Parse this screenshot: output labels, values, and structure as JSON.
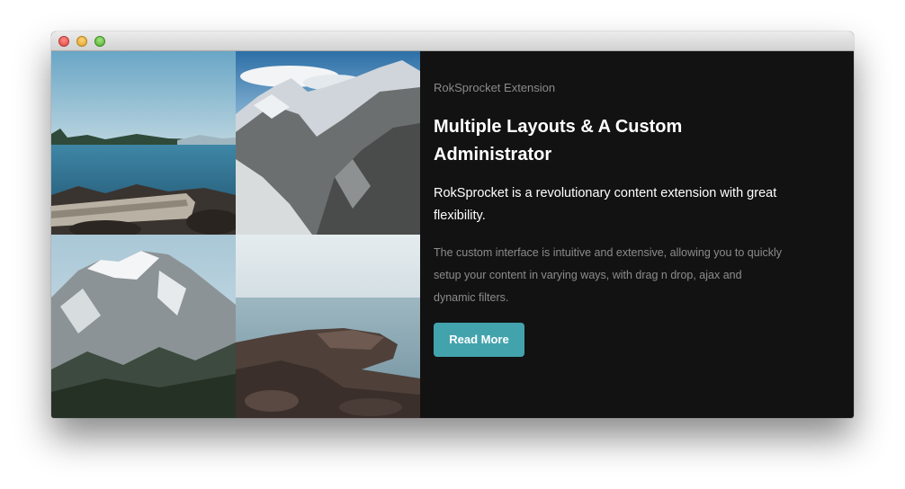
{
  "window": {
    "controls": {
      "close": "close-icon",
      "minimize": "minimize-icon",
      "maximize": "maximize-icon"
    }
  },
  "gallery": {
    "tiles": [
      {
        "scene": "lake-rocks-driftwood"
      },
      {
        "scene": "snowy-mountain-valley"
      },
      {
        "scene": "forested-snowy-peak"
      },
      {
        "scene": "rocky-seashore"
      }
    ]
  },
  "content": {
    "eyebrow": "RokSprocket Extension",
    "title": "Multiple Layouts & A Custom Administrator",
    "lead": "RokSprocket is a revolutionary content extension with great flexibility.",
    "body": "The custom interface is intuitive and extensive, allowing you to quickly setup your content in varying ways, with drag n drop, ajax and dynamic filters.",
    "button_label": "Read More"
  },
  "colors": {
    "panel_background": "#121212",
    "accent": "#43a3ad",
    "heading": "#ffffff",
    "muted_text": "#8c8c8c"
  }
}
